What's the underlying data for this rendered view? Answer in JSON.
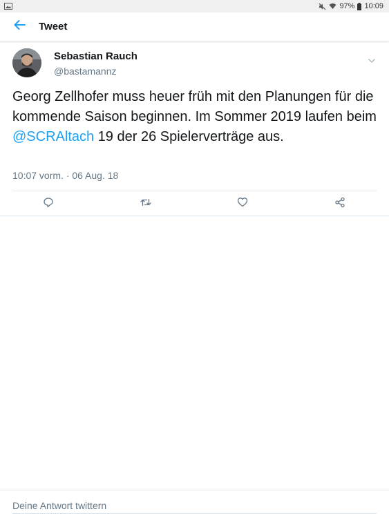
{
  "status_bar": {
    "battery": "97%",
    "time": "10:09",
    "icons": [
      "gallery-icon",
      "mute-icon",
      "wifi-icon",
      "battery-icon"
    ]
  },
  "app_bar": {
    "title": "Tweet",
    "back_icon": "arrow-left-icon"
  },
  "tweet": {
    "author_name": "Sebastian Rauch",
    "author_handle": "@bastamannz",
    "text_before": "Georg Zellhofer muss heuer früh mit den Planungen für die kommende Saison beginnen. Im Sommer 2019 laufen beim ",
    "mention": "@SCRAltach",
    "text_after": " 19 der 26 Spielerverträge aus.",
    "timestamp": "10:07 vorm. · 06 Aug. 18",
    "actions": [
      "reply-icon",
      "retweet-icon",
      "like-icon",
      "share-icon"
    ]
  },
  "reply": {
    "placeholder": "Deine Antwort twittern"
  },
  "colors": {
    "accent": "#1da1f2",
    "text": "#14171a",
    "secondary": "#657786",
    "divider": "#e1e8ed"
  }
}
